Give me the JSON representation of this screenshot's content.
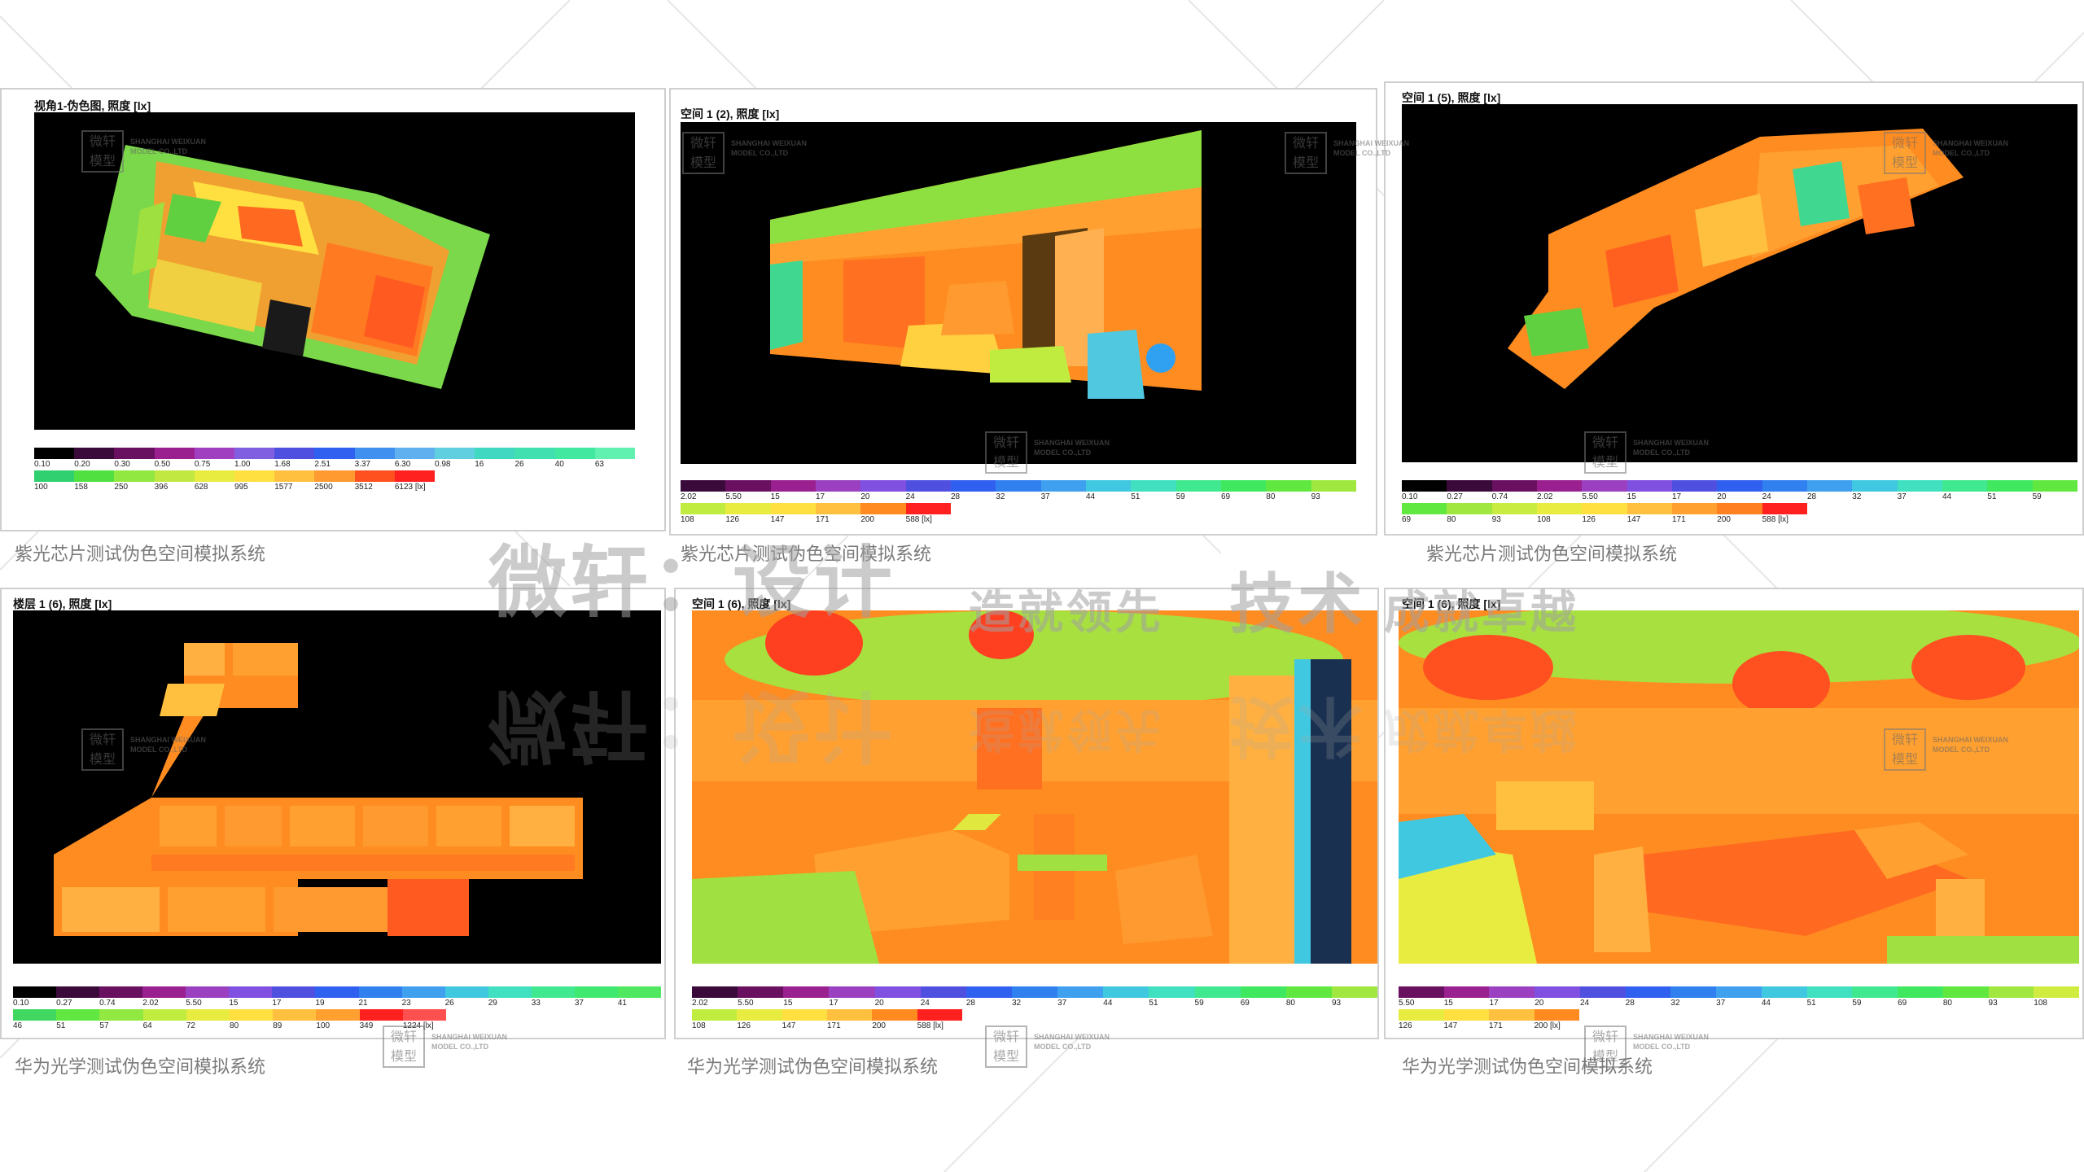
{
  "panels": [
    {
      "title": "视角1-伪色图, 照度 [lx]",
      "caption": "紫光芯片测试伪色空间模拟系统",
      "legend_row1": [
        "0.10",
        "0.20",
        "0.30",
        "0.50",
        "0.75",
        "1.00",
        "1.68",
        "2.51",
        "3.37",
        "6.30",
        "0.98",
        "16",
        "26",
        "40",
        "63"
      ],
      "legend_row2": [
        "100",
        "158",
        "250",
        "396",
        "628",
        "995",
        "1577",
        "2500",
        "3512",
        "6123 [lx]"
      ]
    },
    {
      "title": "空间 1 (2), 照度 [lx]",
      "caption": "紫光芯片测试伪色空间模拟系统",
      "legend_row1": [
        "2.02",
        "5.50",
        "15",
        "17",
        "20",
        "24",
        "28",
        "32",
        "37",
        "44",
        "51",
        "59",
        "69",
        "80",
        "93"
      ],
      "legend_row2": [
        "108",
        "126",
        "147",
        "171",
        "200",
        "588 [lx]"
      ]
    },
    {
      "title": "空间 1 (5), 照度 [lx]",
      "caption": "紫光芯片测试伪色空间模拟系统",
      "legend_row1": [
        "0.10",
        "0.27",
        "0.74",
        "2.02",
        "5.50",
        "15",
        "17",
        "20",
        "24",
        "28",
        "32",
        "37",
        "44",
        "51",
        "59"
      ],
      "legend_row2": [
        "69",
        "80",
        "93",
        "108",
        "126",
        "147",
        "171",
        "200",
        "588 [lx]"
      ]
    },
    {
      "title": "楼层 1 (6), 照度 [lx]",
      "caption": "华为光学测试伪色空间模拟系统",
      "legend_row1": [
        "0.10",
        "0.27",
        "0.74",
        "2.02",
        "5.50",
        "15",
        "17",
        "19",
        "21",
        "23",
        "26",
        "29",
        "33",
        "37",
        "41"
      ],
      "legend_row2": [
        "46",
        "51",
        "57",
        "64",
        "72",
        "80",
        "89",
        "100",
        "349",
        "1224 [lx]"
      ]
    },
    {
      "title": "空间 1 (6), 照度 [lx]",
      "caption": "华为光学测试伪色空间模拟系统",
      "legend_row1": [
        "2.02",
        "5.50",
        "15",
        "17",
        "20",
        "24",
        "28",
        "32",
        "37",
        "44",
        "51",
        "59",
        "69",
        "80",
        "93"
      ],
      "legend_row2": [
        "108",
        "126",
        "147",
        "171",
        "200",
        "588 [lx]"
      ]
    },
    {
      "title": "空间 1 (6), 照度 [lx]",
      "caption": "华为光学测试伪色空间模拟系统",
      "legend_row1": [
        "5.50",
        "15",
        "17",
        "20",
        "24",
        "28",
        "32",
        "37",
        "44",
        "51",
        "59",
        "69",
        "80",
        "93",
        "108"
      ],
      "legend_row2": [
        "126",
        "147",
        "171",
        "200 [lx]"
      ]
    }
  ],
  "watermark": {
    "main_text_1": "微轩：设计",
    "main_text_2": "造就领先",
    "main_text_3": "技术",
    "main_text_4": "成就卓越",
    "badge_logo": "微轩 模型",
    "badge_line1": "SHANGHAI WEIXUAN",
    "badge_line2": "MODEL CO.,LTD"
  },
  "colors": {
    "scale": [
      "#111111",
      "#5a0a3a",
      "#9a1060",
      "#9a20b0",
      "#8060e0",
      "#4050e0",
      "#3070f0",
      "#40a0f0",
      "#20d0d0",
      "#30e090",
      "#40ec40",
      "#90e830",
      "#d8e830",
      "#ffe020",
      "#ffb040",
      "#ff8020",
      "#ff5020",
      "#ff2020"
    ]
  }
}
